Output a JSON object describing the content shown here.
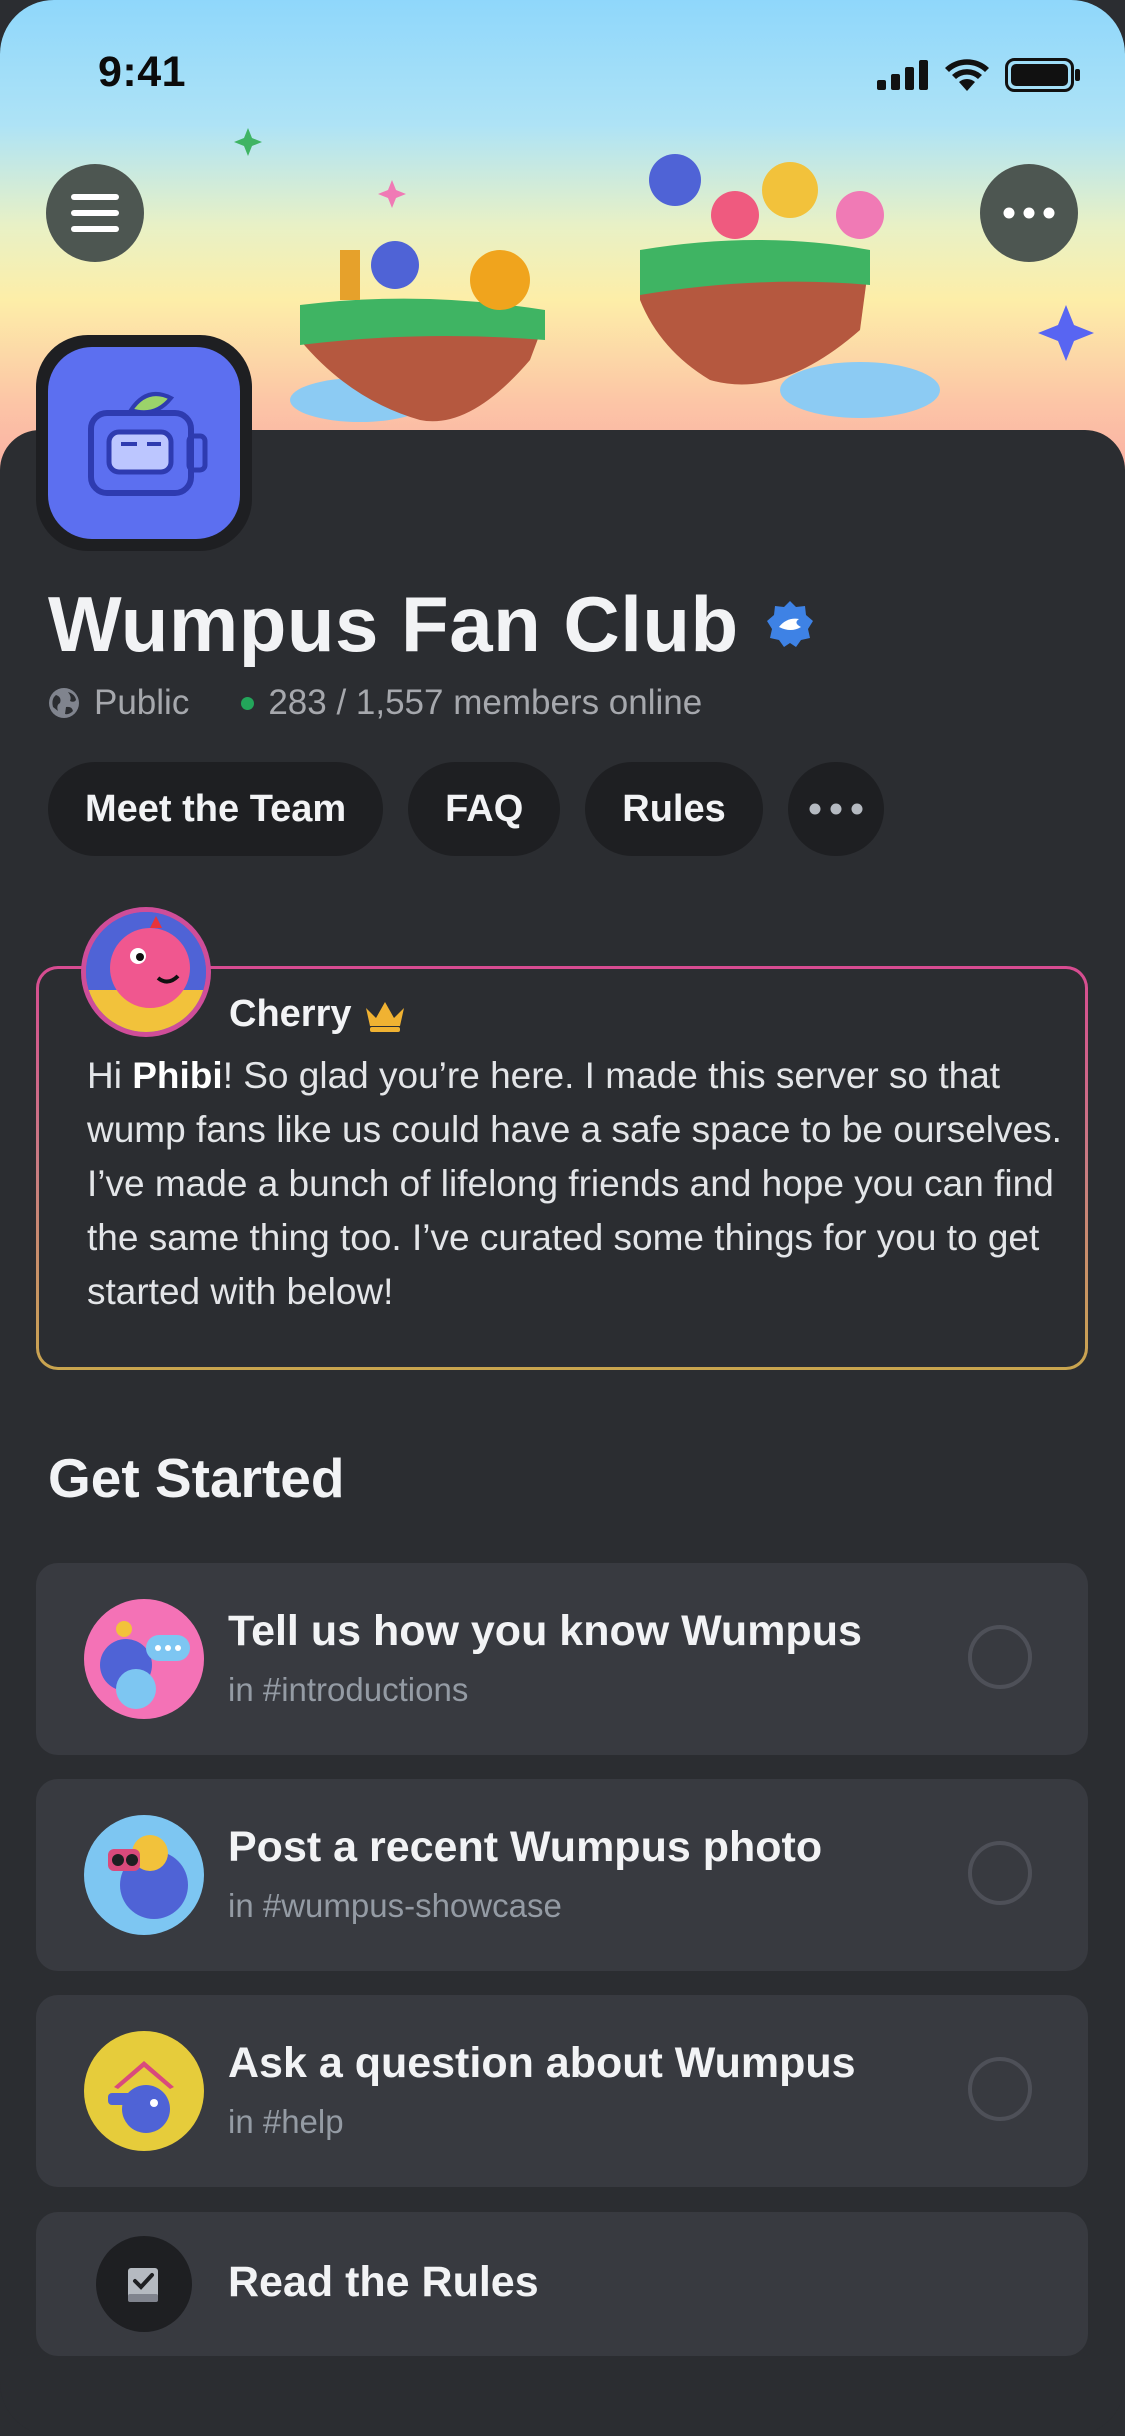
{
  "status_bar": {
    "time": "9:41"
  },
  "server": {
    "name": "Wumpus Fan Club",
    "visibility": "Public",
    "members_online": "283 / 1,557 members online",
    "verified_color": "#3e82e5",
    "icon_color": "#5c6ff0"
  },
  "chips": [
    {
      "label": "Meet the Team"
    },
    {
      "label": "FAQ"
    },
    {
      "label": "Rules"
    }
  ],
  "welcome": {
    "author": "Cherry",
    "text_prefix": "Hi ",
    "text_name": "Phibi",
    "text_body": "! So glad you’re here. I made this server so that wump fans like us could have a safe space to be ourselves. I’ve made a bunch of lifelong friends and hope you can find the same thing too. I’ve curated some things for you to get started with below!"
  },
  "get_started": {
    "title": "Get Started",
    "tasks": [
      {
        "title": "Tell us how you know Wumpus",
        "channel": "in #introductions",
        "completed": false,
        "thumb_color": "#f472b6"
      },
      {
        "title": "Post a recent Wumpus photo",
        "channel": "in #wumpus-showcase",
        "completed": false,
        "thumb_color": "#7dc6f2"
      },
      {
        "title": "Ask a question about Wumpus",
        "channel": "in #help",
        "completed": false,
        "thumb_color": "#e6cc3b"
      }
    ],
    "rules_item": {
      "label": "Read the Rules",
      "icon": "rules-book-icon"
    }
  },
  "icons": {
    "menu": "hamburger-menu-icon",
    "more": "more-dots-icon",
    "globe": "globe-icon",
    "verified": "verified-badge-icon",
    "crown": "crown-icon"
  }
}
